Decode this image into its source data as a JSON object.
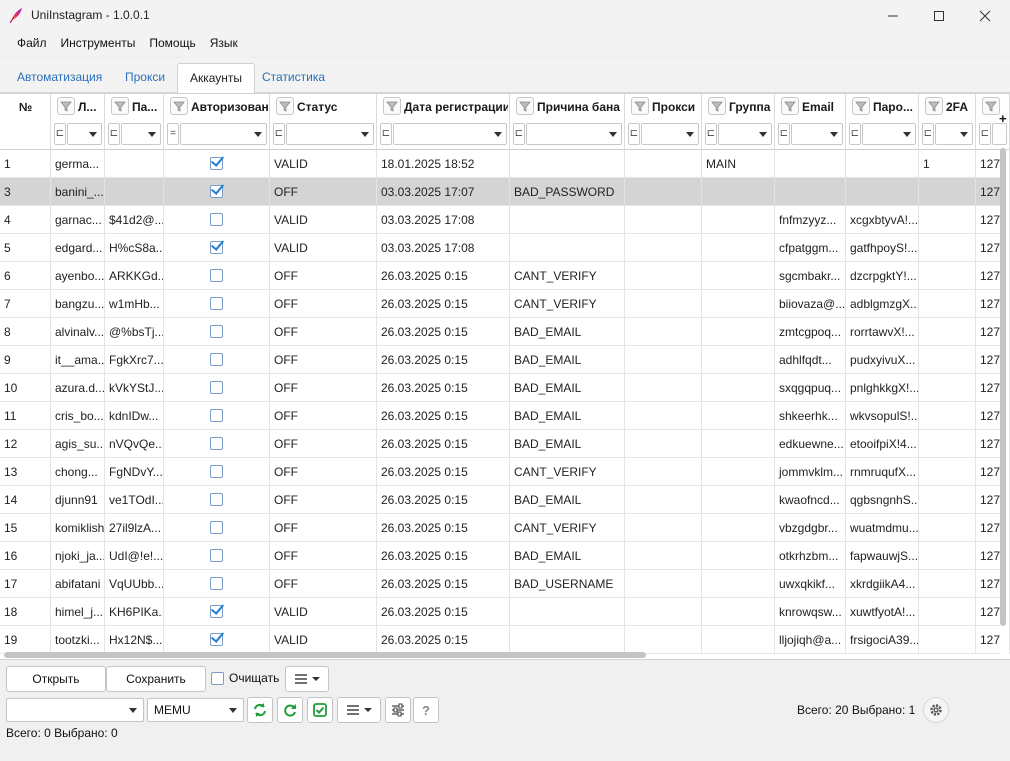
{
  "window": {
    "title": "UniInstagram - 1.0.0.1",
    "app_icon": "feather-icon"
  },
  "menu": [
    "Файл",
    "Инструменты",
    "Помощь",
    "Язык"
  ],
  "tabs": [
    "Автоматизация",
    "Прокси",
    "Аккаунты",
    "Статистика"
  ],
  "active_tab": "Аккаунты",
  "columns": {
    "num": "№",
    "login": "Л...",
    "pass": "Па...",
    "auth": "Авторизован",
    "status": "Статус",
    "reg": "Дата регистрации",
    "ban": "Причина бана",
    "proxy": "Прокси",
    "group": "Группа",
    "email": "Email",
    "epass": "Паро...",
    "twofa": "2FA",
    "filter_eq": "="
  },
  "rows": [
    {
      "num": "1",
      "login": "germa...",
      "pass": "",
      "auth": true,
      "status": "VALID",
      "reg": "18.01.2025 18:52",
      "ban": "",
      "proxy": "",
      "group": "MAIN",
      "email": "",
      "epass": "",
      "twofa": "1",
      "extra": "127"
    },
    {
      "num": "3",
      "login": "banini_...",
      "pass": "",
      "auth": true,
      "status": "OFF",
      "reg": "03.03.2025 17:07",
      "ban": "BAD_PASSWORD",
      "proxy": "",
      "group": "",
      "email": "",
      "epass": "",
      "twofa": "",
      "extra": "127"
    },
    {
      "num": "4",
      "login": "garnac...",
      "pass": "$41d2@...",
      "auth": false,
      "status": "VALID",
      "reg": "03.03.2025 17:08",
      "ban": "",
      "proxy": "",
      "group": "",
      "email": "fnfmzyyz...",
      "epass": "xcgxbtyvA!...",
      "twofa": "",
      "extra": "127"
    },
    {
      "num": "5",
      "login": "edgard...",
      "pass": "H%cS8a...",
      "auth": true,
      "status": "VALID",
      "reg": "03.03.2025 17:08",
      "ban": "",
      "proxy": "",
      "group": "",
      "email": "cfpatggm...",
      "epass": "gatfhpoyS!...",
      "twofa": "",
      "extra": "127"
    },
    {
      "num": "6",
      "login": "ayenbo...",
      "pass": "ARKKGd...",
      "auth": false,
      "status": "OFF",
      "reg": "26.03.2025 0:15",
      "ban": "CANT_VERIFY",
      "proxy": "",
      "group": "",
      "email": "sgcmbakr...",
      "epass": "dzcrpgktY!...",
      "twofa": "",
      "extra": "127"
    },
    {
      "num": "7",
      "login": "bangzu...",
      "pass": "w1mHb...",
      "auth": false,
      "status": "OFF",
      "reg": "26.03.2025 0:15",
      "ban": "CANT_VERIFY",
      "proxy": "",
      "group": "",
      "email": "biiovaza@...",
      "epass": "adblgmzgX...",
      "twofa": "",
      "extra": "127"
    },
    {
      "num": "8",
      "login": "alvinalv...",
      "pass": "@%bsTj...",
      "auth": false,
      "status": "OFF",
      "reg": "26.03.2025 0:15",
      "ban": "BAD_EMAIL",
      "proxy": "",
      "group": "",
      "email": "zmtcgpoq...",
      "epass": "rorrtawvX!...",
      "twofa": "",
      "extra": "127"
    },
    {
      "num": "9",
      "login": "it__ama...",
      "pass": "FgkXrc7...",
      "auth": false,
      "status": "OFF",
      "reg": "26.03.2025 0:15",
      "ban": "BAD_EMAIL",
      "proxy": "",
      "group": "",
      "email": "adhlfqdt...",
      "epass": "pudxyivuX...",
      "twofa": "",
      "extra": "127"
    },
    {
      "num": "10",
      "login": "azura.d...",
      "pass": "kVkYStJ...",
      "auth": false,
      "status": "OFF",
      "reg": "26.03.2025 0:15",
      "ban": "BAD_EMAIL",
      "proxy": "",
      "group": "",
      "email": "sxqgqpuq...",
      "epass": "pnlghkkgX!...",
      "twofa": "",
      "extra": "127"
    },
    {
      "num": "11",
      "login": "cris_bo...",
      "pass": "kdnIDw...",
      "auth": false,
      "status": "OFF",
      "reg": "26.03.2025 0:15",
      "ban": "BAD_EMAIL",
      "proxy": "",
      "group": "",
      "email": "shkeerhk...",
      "epass": "wkvsopulS!...",
      "twofa": "",
      "extra": "127"
    },
    {
      "num": "12",
      "login": "agis_su...",
      "pass": "nVQvQe...",
      "auth": false,
      "status": "OFF",
      "reg": "26.03.2025 0:15",
      "ban": "BAD_EMAIL",
      "proxy": "",
      "group": "",
      "email": "edkuewne...",
      "epass": "etooifpiX!4...",
      "twofa": "",
      "extra": "127"
    },
    {
      "num": "13",
      "login": "chong...",
      "pass": "FgNDvY...",
      "auth": false,
      "status": "OFF",
      "reg": "26.03.2025 0:15",
      "ban": "CANT_VERIFY",
      "proxy": "",
      "group": "",
      "email": "jommvklm...",
      "epass": "rnmruqufX...",
      "twofa": "",
      "extra": "127"
    },
    {
      "num": "14",
      "login": "djunn91",
      "pass": "ve1TOdI...",
      "auth": false,
      "status": "OFF",
      "reg": "26.03.2025 0:15",
      "ban": "BAD_EMAIL",
      "proxy": "",
      "group": "",
      "email": "kwaofncd...",
      "epass": "qgbsngnhS...",
      "twofa": "",
      "extra": "127"
    },
    {
      "num": "15",
      "login": "komiklish",
      "pass": "27il9lzA...",
      "auth": false,
      "status": "OFF",
      "reg": "26.03.2025 0:15",
      "ban": "CANT_VERIFY",
      "proxy": "",
      "group": "",
      "email": "vbzgdgbr...",
      "epass": "wuatmdmu...",
      "twofa": "",
      "extra": "127"
    },
    {
      "num": "16",
      "login": "njoki_ja...",
      "pass": "UdI@!e!...",
      "auth": false,
      "status": "OFF",
      "reg": "26.03.2025 0:15",
      "ban": "BAD_EMAIL",
      "proxy": "",
      "group": "",
      "email": "otkrhzbm...",
      "epass": "fapwauwjS...",
      "twofa": "",
      "extra": "127"
    },
    {
      "num": "17",
      "login": "abifatani",
      "pass": "VqUUbb...",
      "auth": false,
      "status": "OFF",
      "reg": "26.03.2025 0:15",
      "ban": "BAD_USERNAME",
      "proxy": "",
      "group": "",
      "email": "uwxqkikf...",
      "epass": "xkrdgiikA4...",
      "twofa": "",
      "extra": "127"
    },
    {
      "num": "18",
      "login": "himel_j...",
      "pass": "KH6PIKa...",
      "auth": true,
      "status": "VALID",
      "reg": "26.03.2025 0:15",
      "ban": "",
      "proxy": "",
      "group": "",
      "email": "knrowqsw...",
      "epass": "xuwtfyotA!...",
      "twofa": "",
      "extra": "127"
    },
    {
      "num": "19",
      "login": "tootzki...",
      "pass": "Hx12N$...",
      "auth": true,
      "status": "VALID",
      "reg": "26.03.2025 0:15",
      "ban": "",
      "proxy": "",
      "group": "",
      "email": "lljojiqh@a...",
      "epass": "frsigociA39...",
      "twofa": "",
      "extra": "127"
    }
  ],
  "bottom": {
    "open": "Открыть",
    "save": "Сохранить",
    "clear": "Очищать",
    "device": "MEMU",
    "device_left": "",
    "total_right": "Всего: 20  Выбрано: 1",
    "total_left": "Всего: 0  Выбрано: 0"
  },
  "colors": {
    "accent": "#2a6fba",
    "check": "#1f7ecf",
    "green": "#1f9d3a",
    "selected_row": "#d4d4d4"
  }
}
